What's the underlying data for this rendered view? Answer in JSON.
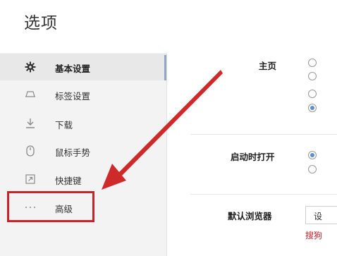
{
  "page_title": "选项",
  "sidebar": {
    "items": [
      {
        "label": "基本设置",
        "icon": "gear-icon",
        "active": true
      },
      {
        "label": "标签设置",
        "icon": "tab-icon"
      },
      {
        "label": "下载",
        "icon": "download-icon"
      },
      {
        "label": "鼠标手势",
        "icon": "mouse-icon"
      },
      {
        "label": "快捷键",
        "icon": "shortcut-icon"
      },
      {
        "label": "高级",
        "icon": "more-icon"
      }
    ]
  },
  "main": {
    "homepage_label": "主页",
    "startup_label": "启动时打开",
    "default_browser_label": "默认浏览器",
    "default_browser_button": "设",
    "default_browser_note": "搜狗"
  },
  "colors": {
    "annotation_red": "#c6232b",
    "active_accent": "#8fa6c7",
    "radio_checked": "#5a8fd0"
  }
}
